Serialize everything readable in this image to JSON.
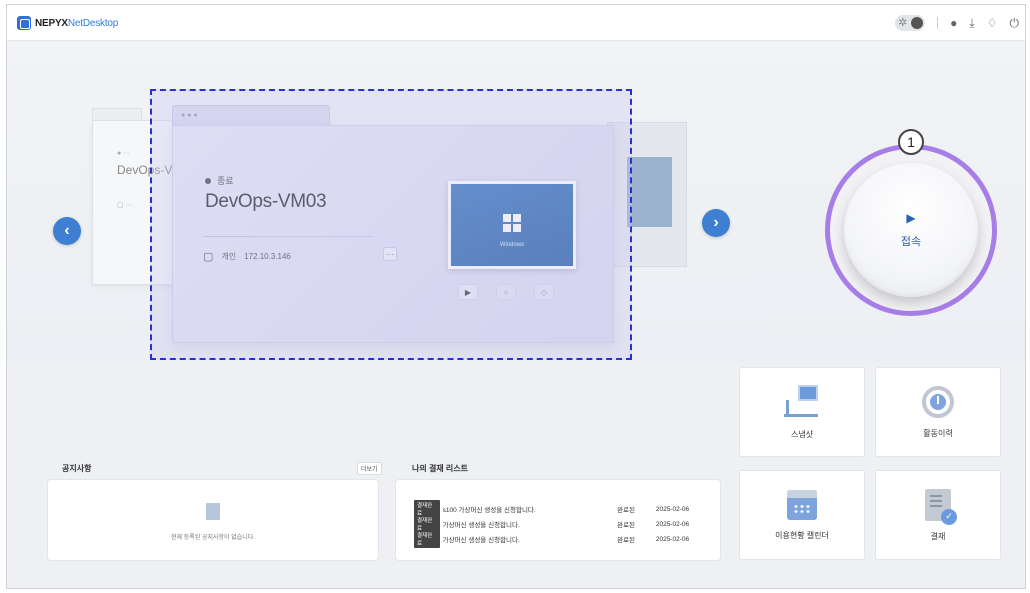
{
  "app": {
    "logo_name": "NEPYX",
    "logo_accent": "NetDesktop"
  },
  "header": {
    "theme_icon": "sun-icon",
    "icons": [
      "user-icon",
      "download-icon",
      "bell-icon",
      "power-icon"
    ]
  },
  "carousel": {
    "prev_ghost_title": "DevOps-V",
    "vm": {
      "status": "종료",
      "name": "DevOps-VM03",
      "type": "개인",
      "ip": "172.10.3.146",
      "more": "···",
      "os_label": "Windows"
    },
    "controls": [
      "▶",
      "○",
      "◇"
    ]
  },
  "connect": {
    "step": "1",
    "label": "접속",
    "play": "▶"
  },
  "tiles": [
    {
      "label": "스냅샷"
    },
    {
      "label": "활동이력"
    },
    {
      "label": "이용현황 캘린더"
    },
    {
      "label": "결재"
    }
  ],
  "notices": {
    "title": "공지사항",
    "more": "더보기",
    "empty_text": "현재 등록된 공지사항이 없습니다."
  },
  "payments": {
    "title": "나의 결재 리스트",
    "rows": [
      {
        "badge": "결재완료",
        "text": "s100 가상머신 생성을 신청합니다.",
        "status": "완료된",
        "date": "2025-02-06"
      },
      {
        "badge": "결재완료",
        "text": "가상머신 생성을 신청합니다.",
        "status": "완료된",
        "date": "2025-02-06"
      },
      {
        "badge": "결재완료",
        "text": "가상머신 생성을 신청합니다.",
        "status": "완료된",
        "date": "2025-02-06"
      }
    ]
  },
  "colors": {
    "accent": "#3f7fd3",
    "ring": "#a77ee7",
    "selection": "#2b2fd0"
  }
}
